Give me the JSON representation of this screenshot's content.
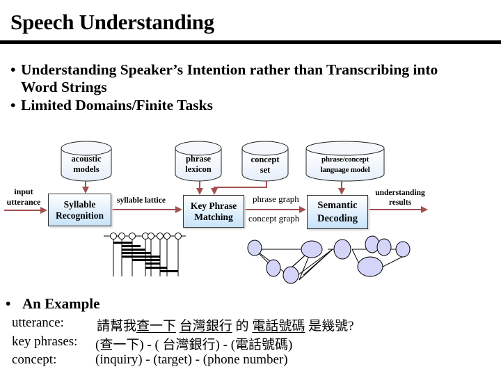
{
  "slide": {
    "title": "Speech Understanding"
  },
  "bullets": [
    {
      "marker": "•",
      "line1": "Understanding Speaker’s Intention rather than Transcribing into",
      "line2": "Word Strings"
    },
    {
      "marker": "•",
      "line1": "Limited Domains/Finite Tasks"
    }
  ],
  "diagram": {
    "databases": {
      "acoustic": [
        "acoustic",
        "models"
      ],
      "lexicon": [
        "phrase",
        "lexicon"
      ],
      "concept_set": [
        "concept",
        "set"
      ],
      "language_model": [
        "phrase/concept",
        "language model"
      ]
    },
    "processes": {
      "syllable": [
        "Syllable",
        "Recognition"
      ],
      "key_phrase": [
        "Key Phrase",
        "Matching"
      ],
      "semantic": [
        "Semantic",
        "Decoding"
      ]
    },
    "edges": {
      "input": [
        "input",
        "utterance"
      ],
      "lattice": "syllable lattice",
      "phrase_graph": "phrase graph",
      "concept_graph": "concept graph",
      "output": [
        "understanding",
        "results"
      ]
    },
    "colors": {
      "arrow": "#a05050",
      "box_fill": "#d7ebfb",
      "node_fill": "#d4d4f8"
    }
  },
  "example": {
    "marker": "•",
    "heading": "An Example",
    "rows": [
      {
        "label": "utterance:",
        "segments": [
          {
            "text": "請幫我",
            "underline": false
          },
          {
            "text": "查一下",
            "underline": true
          },
          {
            "text": " ",
            "underline": false
          },
          {
            "text": "台灣銀行",
            "underline": true
          },
          {
            "text": " 的 ",
            "underline": false
          },
          {
            "text": "電話號碼",
            "underline": true
          },
          {
            "text": " 是幾號?",
            "underline": false
          }
        ]
      },
      {
        "label": "key phrases:",
        "value": "(查一下) - ( 台灣銀行) - (電話號碼)"
      },
      {
        "label": "concept:",
        "value": "(inquiry) - (target) - (phone number)"
      }
    ]
  }
}
